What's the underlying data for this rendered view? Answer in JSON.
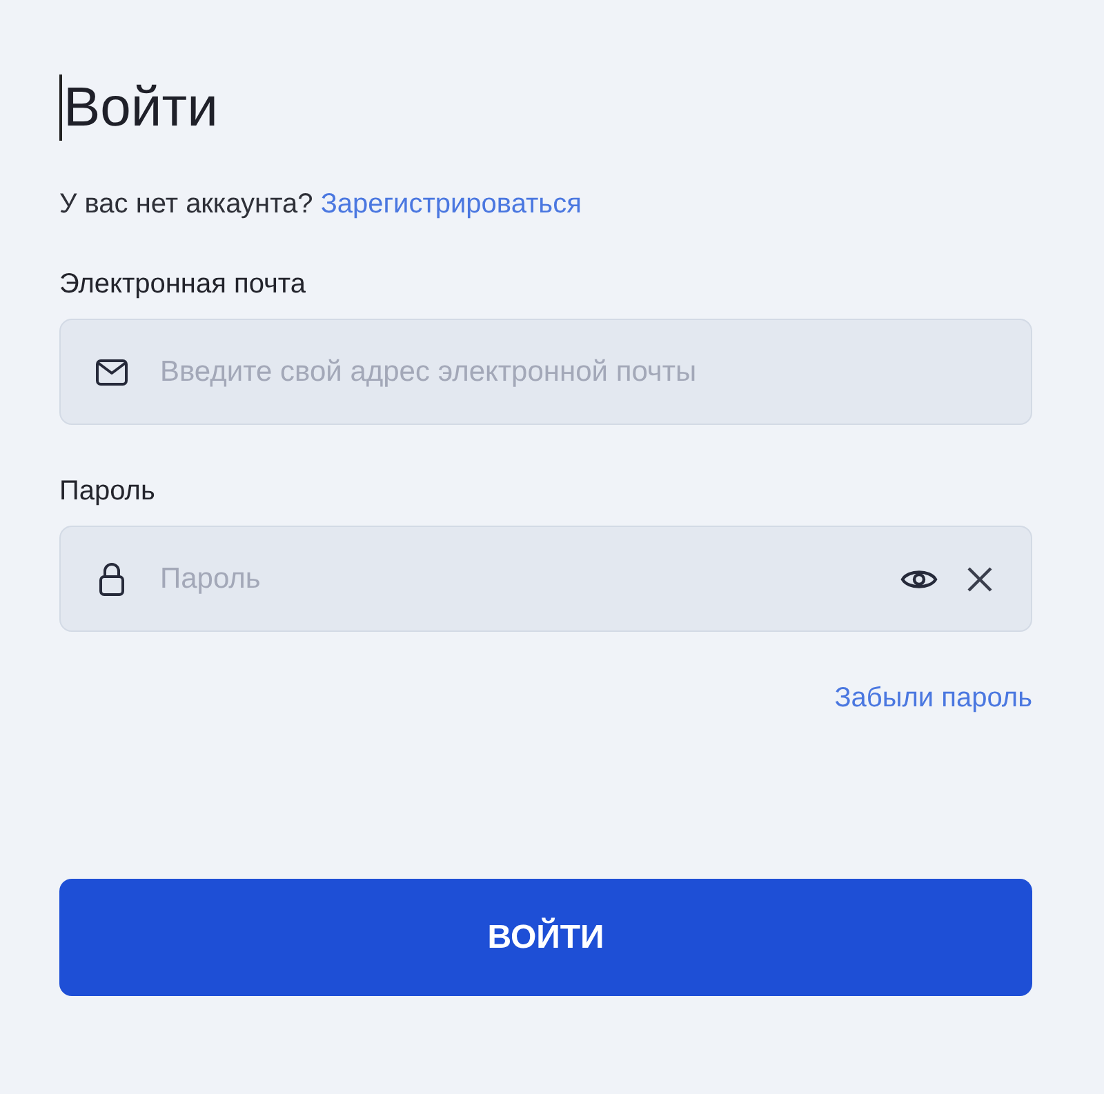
{
  "title": "Войти",
  "signup_prompt": {
    "text": "У вас нет аккаунта?",
    "link": "Зарегистрироваться"
  },
  "fields": [
    {
      "kind": "email",
      "label": "Электронная почта",
      "placeholder": "Введите свой адрес электронной почты"
    },
    {
      "kind": "password",
      "label": "Пароль",
      "placeholder": "Пароль"
    }
  ],
  "forgot_link": "Забыли пароль",
  "submit_button": "ВОЙТИ"
}
